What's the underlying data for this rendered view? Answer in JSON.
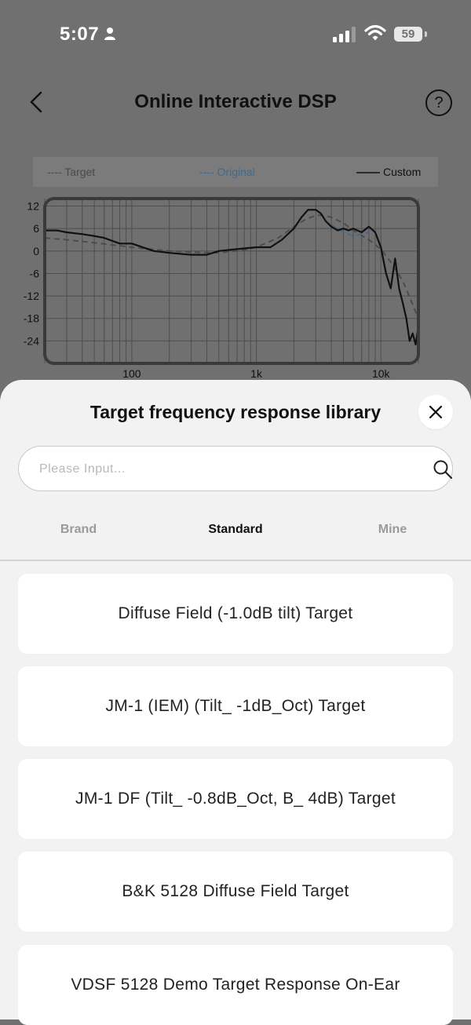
{
  "status_bar": {
    "time": "5:07",
    "battery": "59"
  },
  "nav": {
    "title": "Online Interactive DSP",
    "help_glyph": "?"
  },
  "legend": {
    "target": "---- Target",
    "original": "---- Original",
    "custom": "Custom"
  },
  "chart_data": {
    "type": "line",
    "x_scale": "log",
    "xlim": [
      20,
      20000
    ],
    "ylim": [
      -30,
      14
    ],
    "y_ticks": [
      "12",
      "6",
      "0",
      "-6",
      "-12",
      "-18",
      "-24"
    ],
    "x_ticks": [
      "100",
      "1k",
      "10k"
    ],
    "series": [
      {
        "name": "Target",
        "style": "dashed",
        "color": "#4a4a4a",
        "x": [
          20,
          30,
          50,
          100,
          200,
          300,
          500,
          800,
          1000,
          1500,
          2000,
          2500,
          3000,
          3500,
          4000,
          5000,
          6000,
          8000,
          10000,
          12000,
          15000,
          20000
        ],
        "y": [
          3.5,
          3,
          2.2,
          1,
          0,
          -0.3,
          -0.5,
          0.3,
          1,
          3.5,
          6.5,
          8.5,
          9.5,
          9.5,
          9,
          7.5,
          5.5,
          3,
          0.5,
          -3,
          -8,
          -18
        ]
      },
      {
        "name": "Original",
        "style": "dashed",
        "color": "#3e6a92",
        "x": [
          4000,
          5000,
          6000,
          7000,
          8000
        ],
        "y": [
          7,
          5,
          4,
          4.5,
          5
        ]
      },
      {
        "name": "Custom",
        "style": "solid",
        "color": "#111111",
        "x": [
          20,
          25,
          30,
          40,
          50,
          60,
          80,
          100,
          150,
          200,
          300,
          400,
          500,
          700,
          1000,
          1300,
          1600,
          2000,
          2300,
          2600,
          3000,
          3300,
          3600,
          4000,
          4500,
          5000,
          5500,
          6000,
          7000,
          8000,
          9000,
          10000,
          11000,
          12000,
          13000,
          14000,
          15000,
          16000,
          17000,
          18000,
          19000,
          20000
        ],
        "y": [
          5.5,
          5.5,
          5,
          4.5,
          4,
          3.5,
          2,
          2,
          0,
          -0.5,
          -1,
          -1,
          0,
          0.5,
          1,
          1,
          3,
          6,
          9,
          11,
          11,
          10,
          8,
          6.5,
          5.5,
          6,
          5.5,
          6,
          5,
          6.5,
          5,
          1,
          -6,
          -10,
          -2,
          -10,
          -14,
          -18,
          -24,
          -22,
          -25,
          -20
        ]
      }
    ]
  },
  "sheet": {
    "title": "Target frequency response library",
    "close_glyph": "✕",
    "search_placeholder": "Please Input...",
    "tabs": [
      "Brand",
      "Standard",
      "Mine"
    ],
    "active_tab": "Standard",
    "items": [
      "Diffuse Field (-1.0dB tilt) Target",
      "JM-1 (IEM) (Tilt_ -1dB_Oct) Target",
      "JM-1 DF (Tilt_ -0.8dB_Oct, B_ 4dB) Target",
      "B&K 5128 Diffuse Field Target",
      "VDSF 5128 Demo Target Response On-Ear"
    ]
  }
}
